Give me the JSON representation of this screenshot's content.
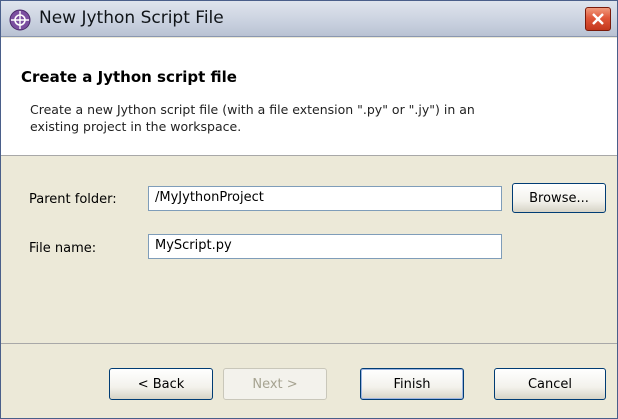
{
  "window": {
    "title": "New Jython Script File",
    "icon": "plugin-icon",
    "close_icon": "close-icon"
  },
  "banner": {
    "title": "Create a Jython script file",
    "description": "Create a new Jython script file (with a file extension \".py\" or \".jy\") in an existing project in the workspace."
  },
  "form": {
    "parent_folder_label": "Parent folder:",
    "parent_folder_value": "/MyJythonProject",
    "browse_label": "Browse...",
    "file_name_label": "File name:",
    "file_name_value": "MyScript.py"
  },
  "buttons": {
    "back": "< Back",
    "next": "Next >",
    "finish": "Finish",
    "cancel": "Cancel"
  },
  "colors": {
    "titlebar": "#c9d1df",
    "close_button": "#e0573a",
    "dialog_background": "#ece9d8"
  }
}
